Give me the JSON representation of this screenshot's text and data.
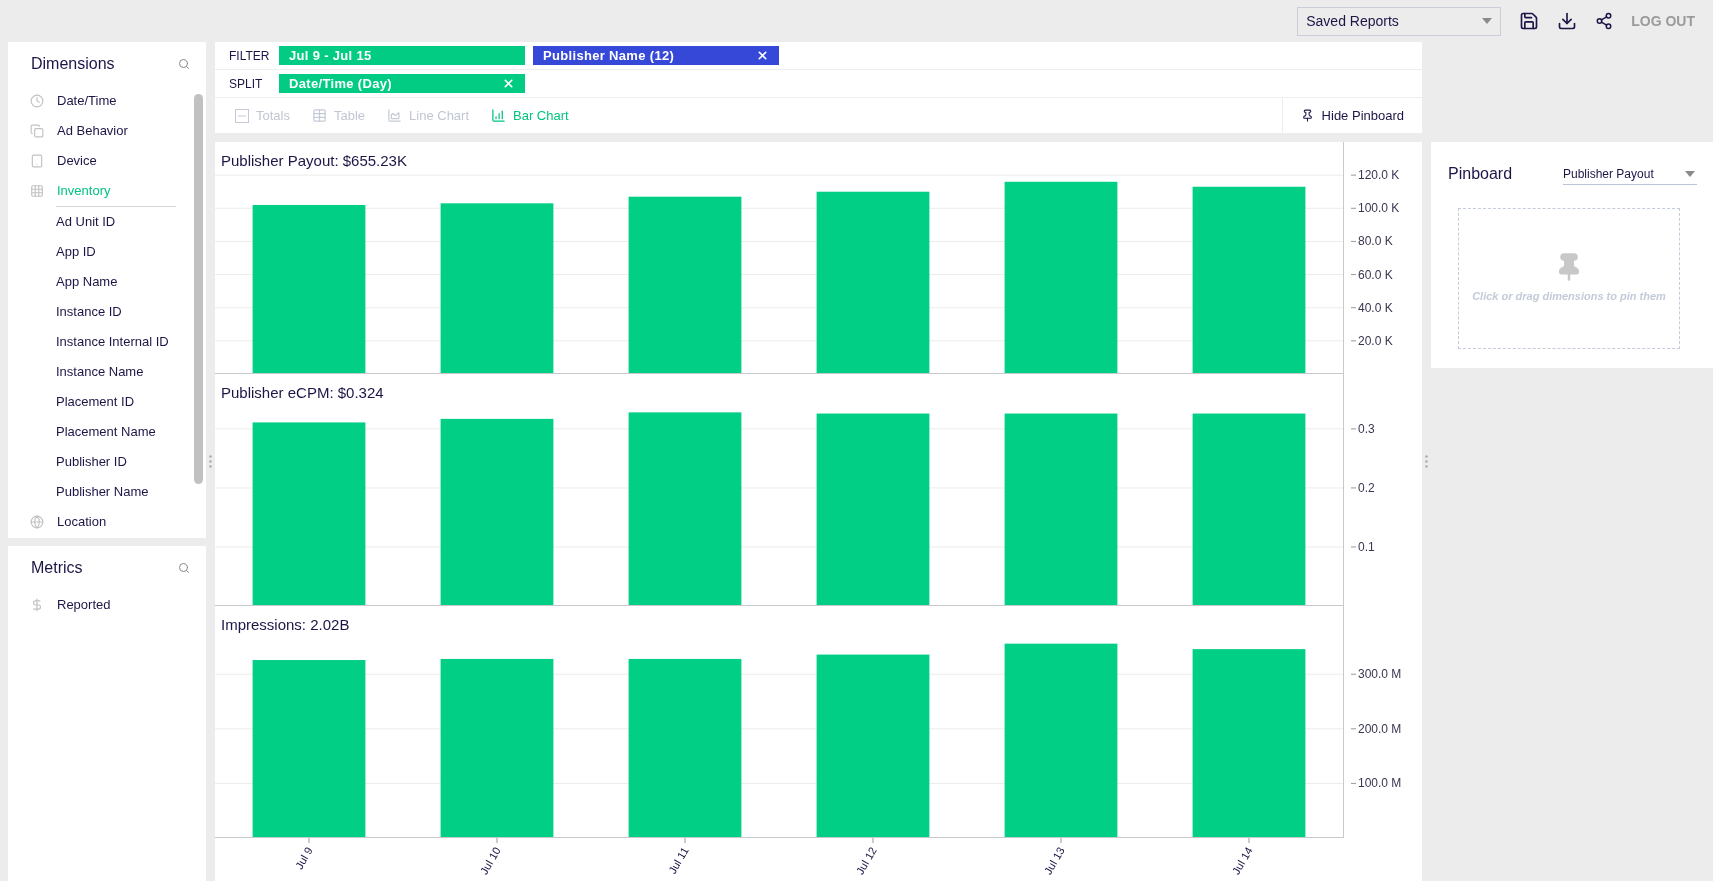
{
  "top_bar": {
    "saved_reports": {
      "value": "Saved Reports"
    },
    "logout": "LOG OUT"
  },
  "dimensions": {
    "title": "Dimensions",
    "items": [
      {
        "label": "Date/Time",
        "selected": false
      },
      {
        "label": "Ad Behavior",
        "selected": false
      },
      {
        "label": "Device",
        "selected": false
      },
      {
        "label": "Inventory",
        "selected": true,
        "children": [
          {
            "label": "Ad Unit ID"
          },
          {
            "label": "App ID"
          },
          {
            "label": "App Name"
          },
          {
            "label": "Instance ID"
          },
          {
            "label": "Instance Internal ID"
          },
          {
            "label": "Instance Name"
          },
          {
            "label": "Placement ID"
          },
          {
            "label": "Placement Name"
          },
          {
            "label": "Publisher ID"
          },
          {
            "label": "Publisher Name"
          }
        ]
      },
      {
        "label": "Location",
        "selected": false
      }
    ]
  },
  "metrics": {
    "title": "Metrics",
    "items": [
      {
        "label": "Reported"
      }
    ]
  },
  "filter": {
    "label": "FILTER",
    "chips": [
      {
        "text": "Jul 9 - Jul 15",
        "color": "#02cc84",
        "removable": false
      },
      {
        "text": "Publisher Name (12)",
        "color": "#3548d8",
        "removable": true
      }
    ]
  },
  "split": {
    "label": "SPLIT",
    "chips": [
      {
        "text": "Date/Time (Day)",
        "color": "#02cc84",
        "removable": true
      }
    ]
  },
  "views": [
    {
      "label": "Totals",
      "selected": false
    },
    {
      "label": "Table",
      "selected": false
    },
    {
      "label": "Line Chart",
      "selected": false
    },
    {
      "label": "Bar Chart",
      "selected": true
    }
  ],
  "hide_pinboard": "Hide Pinboard",
  "charts": [
    {
      "chart_data": {
        "type": "bar",
        "title": "Publisher Payout: $655.23K",
        "values": [
          102000,
          103000,
          107000,
          110000,
          116000,
          113000
        ],
        "ylim": [
          0,
          140000
        ],
        "grid": true,
        "yticks": [
          {
            "value": 20000,
            "label": "20.0 K"
          },
          {
            "value": 40000,
            "label": "40.0 K"
          },
          {
            "value": 60000,
            "label": "60.0 K"
          },
          {
            "value": 80000,
            "label": "80.0 K"
          },
          {
            "value": 100000,
            "label": "100.0 K"
          },
          {
            "value": 120000,
            "label": "120.0 K"
          }
        ]
      }
    },
    {
      "chart_data": {
        "type": "bar",
        "title": "Publisher eCPM: $0.324",
        "values": [
          0.311,
          0.317,
          0.328,
          0.326,
          0.326,
          0.326
        ],
        "ylim": [
          0,
          0.393
        ],
        "grid": true,
        "yticks": [
          {
            "value": 0.1,
            "label": "0.1"
          },
          {
            "value": 0.2,
            "label": "0.2"
          },
          {
            "value": 0.3,
            "label": "0.3"
          }
        ]
      }
    },
    {
      "chart_data": {
        "type": "bar",
        "title": "Impressions: 2.02B",
        "categories": [
          "Jul 9",
          "Jul 10",
          "Jul 11",
          "Jul 12",
          "Jul 13",
          "Jul 14"
        ],
        "values": [
          326000000,
          328000000,
          328000000,
          336000000,
          356000000,
          346000000
        ],
        "ylim": [
          0,
          425000000
        ],
        "grid": true,
        "yticks": [
          {
            "value": 100000000,
            "label": "100.0 M"
          },
          {
            "value": 200000000,
            "label": "200.0 M"
          },
          {
            "value": 300000000,
            "label": "300.0 M"
          }
        ]
      }
    }
  ],
  "pinboard": {
    "title": "Pinboard",
    "measure": {
      "value": "Publisher Payout"
    },
    "hint": "Click or drag dimensions to pin them"
  }
}
